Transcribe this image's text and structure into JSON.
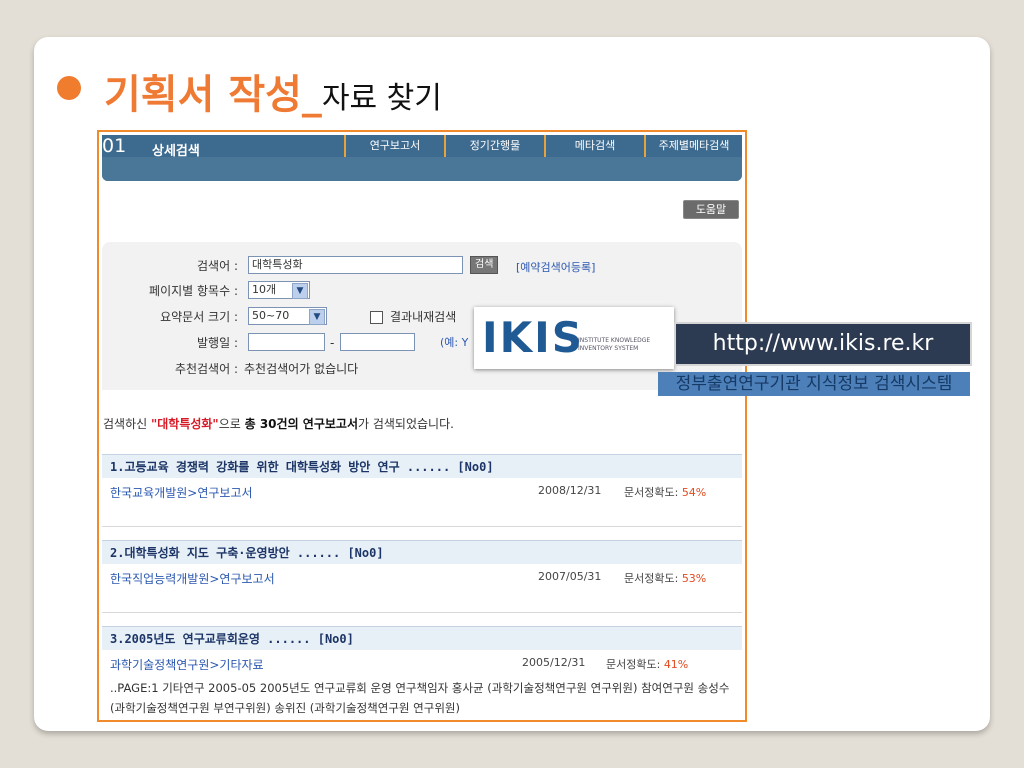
{
  "slide": {
    "heading_main": "기획서 작성_",
    "heading_sub": "자료 찾기"
  },
  "app": {
    "section_number": "01",
    "section_title": "상세검색",
    "tabs": [
      "연구보고서",
      "정기간행물",
      "메타검색",
      "주제별메타검색"
    ],
    "help_label": "도움말"
  },
  "form": {
    "keyword_label": "검색어 :",
    "keyword_value": "대학특성화",
    "search_button": "검색",
    "reserve_link": "[예약검색어등록]",
    "page_items_label": "페이지별 항목수 :",
    "page_items_value": "10개",
    "summary_size_label": "요약문서 크기 :",
    "summary_size_value": "50~70",
    "research_within_label": "결과내재검색",
    "pub_date_label": "발행일 :",
    "date_separator": "-",
    "example_text": "(예: Y",
    "recommend_label": "추천검색어 :",
    "recommend_value": "추천검색어가 없습니다"
  },
  "overlay": {
    "logo_text": "IKIS",
    "logo_sub_line1": "INSTITUTE KNOWLEDGE",
    "logo_sub_line2": "INVENTORY SYSTEM",
    "url": "http://www.ikis.re.kr",
    "gov_label": "정부출연연구기관 지식정보 검색시스템"
  },
  "summary": {
    "prefix": "검색하신 ",
    "keyword": "\"대학특성화\"",
    "mid": "으로 ",
    "count_text": "총 30건의 연구보고서",
    "suffix": "가 검색되었습니다."
  },
  "results": [
    {
      "title": "1.고등교육 경쟁력 강화를 위한 대학특성화 방안 연구 ...... [No0]",
      "source": "한국교육개발원>연구보고서",
      "date": "2008/12/31",
      "accuracy_label": "문서정확도:",
      "accuracy_value": "54%"
    },
    {
      "title": "2.대학특성화 지도 구축·운영방안 ...... [No0]",
      "source": "한국직업능력개발원>연구보고서",
      "date": "2007/05/31",
      "accuracy_label": "문서정확도:",
      "accuracy_value": "53%"
    },
    {
      "title": "3.2005년도 연구교류회운영 ...... [No0]",
      "source": "과학기술정책연구원>기타자료",
      "date": "2005/12/31",
      "accuracy_label": "문서정확도:",
      "accuracy_value": "41%",
      "snippet": "..PAGE:1 기타연구 2005-05 2005년도 연구교류회 운영 연구책임자 홍사균 (과학기술정책연구원 연구위원) 참여연구원 송성수 (과학기술정책연구원 부연구위원) 송위진 (과학기술정책연구원 연구위원)"
    }
  ],
  "colors": {
    "accent_orange": "#f07c2e",
    "tab_blue": "#3d6a8f",
    "accuracy_red": "#e34a1f"
  }
}
